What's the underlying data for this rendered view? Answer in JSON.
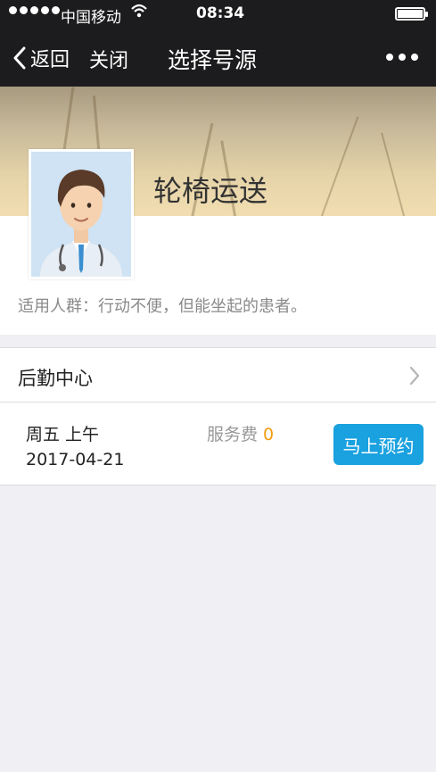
{
  "status_bar": {
    "carrier": "中国移动",
    "time": "08:34",
    "icons": [
      "signal-dots-icon",
      "wifi-icon",
      "battery-icon"
    ]
  },
  "nav": {
    "back_label": "返回",
    "close_label": "关闭",
    "title": "选择号源",
    "icons": [
      "chevron-left-icon",
      "more-icon"
    ]
  },
  "service": {
    "name": "轮椅运送",
    "description": "适用人群：行动不便，但能坐起的患者。",
    "avatar_icon": "doctor-avatar-icon"
  },
  "department": {
    "label": "后勤中心",
    "icon": "chevron-right-icon"
  },
  "slot": {
    "day": "周五 上午",
    "date": "2017-04-21",
    "fee_label": "服务费",
    "fee_value": "0",
    "book_label": "马上预约"
  },
  "colors": {
    "nav_bg": "#1c1c1e",
    "accent": "#1aa1df",
    "fee_value": "#f39c12",
    "page_bg": "#efeff4"
  }
}
